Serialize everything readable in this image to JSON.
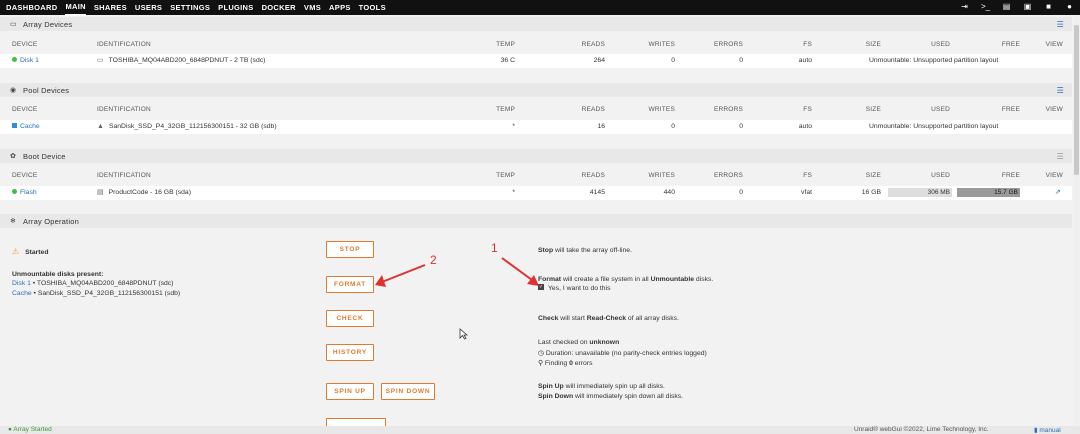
{
  "nav": {
    "items": [
      "DASHBOARD",
      "MAIN",
      "SHARES",
      "USERS",
      "SETTINGS",
      "PLUGINS",
      "DOCKER",
      "VMS",
      "APPS",
      "TOOLS"
    ],
    "active": "MAIN",
    "icons": [
      "logout-icon",
      "terminal-icon",
      "feedback-icon",
      "info-icon",
      "lock-icon",
      "help-icon"
    ]
  },
  "columns": {
    "device": "DEVICE",
    "identification": "IDENTIFICATION",
    "temp": "TEMP",
    "reads": "READS",
    "writes": "WRITES",
    "errors": "ERRORS",
    "fs": "FS",
    "size": "SIZE",
    "used": "USED",
    "free": "FREE",
    "view": "VIEW"
  },
  "array_devices": {
    "title": "Array Devices",
    "row": {
      "device": "Disk 1",
      "identification": "TOSHIBA_MQ04ABD200_6848PDNUT - 2 TB (sdc)",
      "temp": "36 C",
      "reads": "264",
      "writes": "0",
      "errors": "0",
      "fs": "auto",
      "status": "Unmountable: Unsupported partition layout"
    }
  },
  "pool_devices": {
    "title": "Pool Devices",
    "row": {
      "device": "Cache",
      "identification": "SanDisk_SSD_P4_32GB_112156300151 - 32 GB (sdb)",
      "temp": "*",
      "reads": "16",
      "writes": "0",
      "errors": "0",
      "fs": "auto",
      "status": "Unmountable: Unsupported partition layout"
    }
  },
  "boot_device": {
    "title": "Boot Device",
    "row": {
      "device": "Flash",
      "identification": "ProductCode - 16 GB (sda)",
      "temp": "*",
      "reads": "4145",
      "writes": "440",
      "errors": "0",
      "fs": "vfat",
      "size": "16 GB",
      "used": "306 MB",
      "free": "15.7 GB",
      "used_fraction": 0.02
    }
  },
  "array_operation": {
    "title": "Array Operation",
    "status": "Started",
    "unmountable_title": "Unmountable disks present:",
    "unmountable": [
      {
        "name": "Disk 1",
        "desc": "• TOSHIBA_MQ04ABD200_6848PDNUT (sdc)"
      },
      {
        "name": "Cache",
        "desc": "• SanDisk_SSD_P4_32GB_112156300151 (sdb)"
      }
    ],
    "buttons": {
      "stop": "STOP",
      "format": "FORMAT",
      "check": "CHECK",
      "history": "HISTORY",
      "spin_up": "SPIN UP",
      "spin_down": "SPIN DOWN"
    },
    "stop_text": {
      "bold": "Stop",
      "rest": "will take the array off-line."
    },
    "format_text": {
      "bold": "Format",
      "mid": "will create a file system in all",
      "bold2": "Unmountable",
      "end": "disks."
    },
    "confirm": "Yes, I want to do this",
    "check_text": {
      "bold": "Check",
      "mid": "will start",
      "bold2": "Read-Check",
      "end": "of all array disks."
    },
    "last_checked": {
      "prefix": "Last checked on",
      "value": "unknown"
    },
    "duration": "Duration: unavailable (no parity-check entries logged)",
    "finding": {
      "prefix": "Finding",
      "value": "0",
      "suffix": "errors"
    },
    "spin_up_text": {
      "bold": "Spin Up",
      "rest": "will immediately spin up all disks."
    },
    "spin_down_text": {
      "bold": "Spin Down",
      "rest": "will immediately spin down all disks."
    }
  },
  "annotations": {
    "label1": "1",
    "label2": "2",
    "color": "#e03030"
  },
  "footer": {
    "status": "Array Started",
    "copyright": "Unraid® webGui ©2022, Lime Technology, Inc.",
    "manual": "manual"
  },
  "colors": {
    "accent": "#e07a2f",
    "link": "#2a6ebb",
    "online": "#3fbf3f",
    "warning": "#f0a020"
  }
}
